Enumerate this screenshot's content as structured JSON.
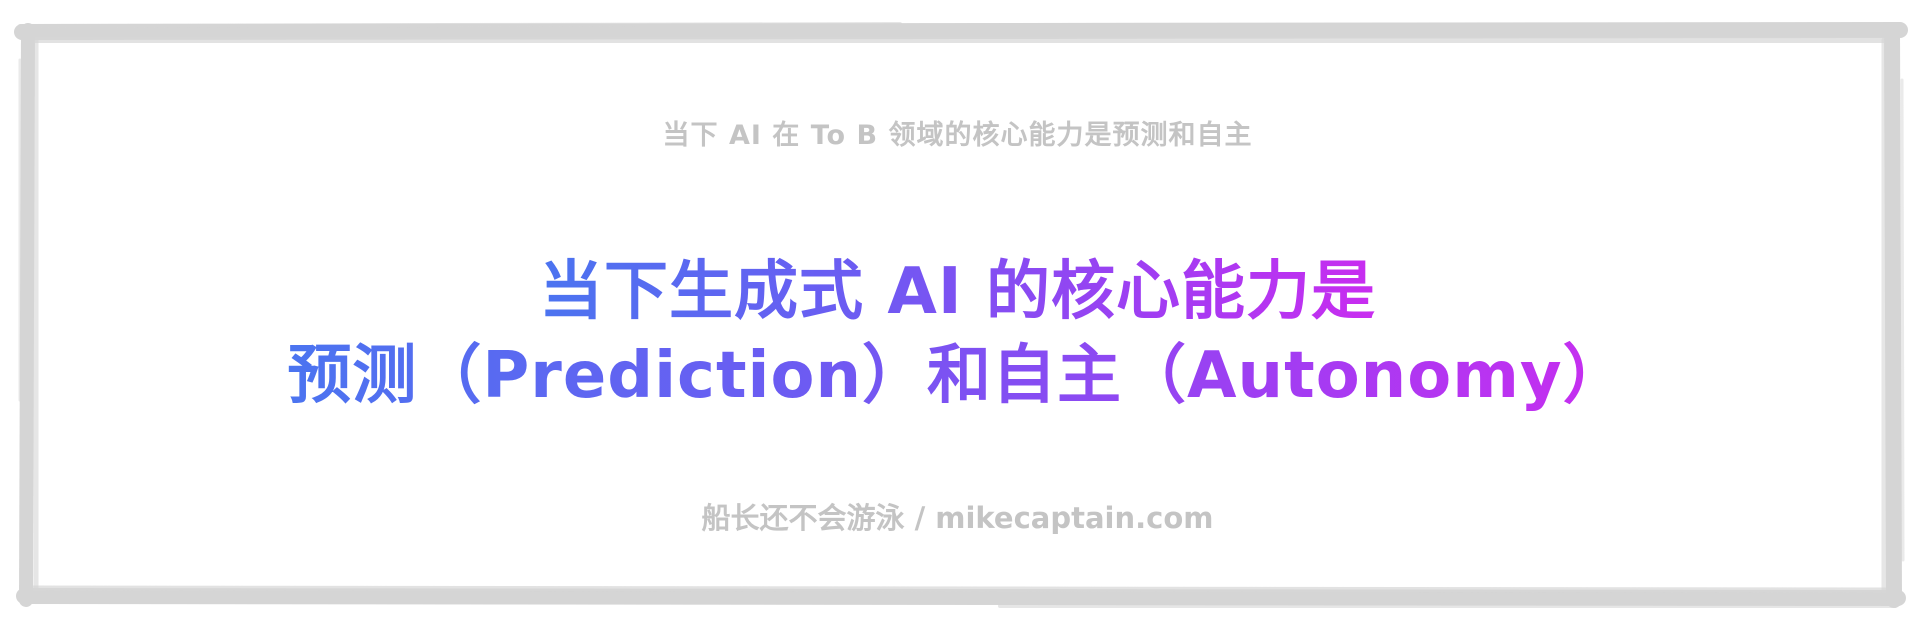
{
  "subtitle": "当下 AI 在 To B 领域的核心能力是预测和自主",
  "headline": {
    "line1": "当下生成式 AI 的核心能力是",
    "line2": "预测（Prediction）和自主（Autonomy）"
  },
  "footer": "船长还不会游泳 / mikecaptain.com",
  "colors": {
    "frame": "#d5d5d5",
    "gray_text": "#c4c4c4",
    "gradient_start": "#4b74f0",
    "gradient_end": "#c92df0"
  }
}
